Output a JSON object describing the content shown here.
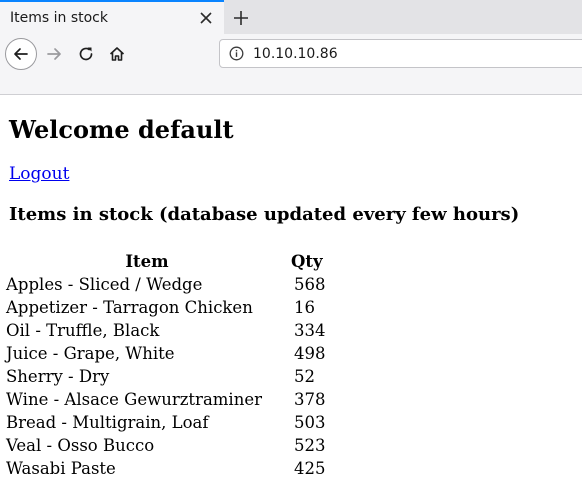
{
  "browser": {
    "tab_title": "Items in stock",
    "url": "10.10.10.86",
    "accent_color": "#0a84ff"
  },
  "page": {
    "welcome": "Welcome default",
    "logout_label": "Logout",
    "heading": "Items in stock (database updated every few hours)",
    "table": {
      "headers": [
        "Item",
        "Qty"
      ],
      "rows": [
        [
          "Apples - Sliced / Wedge",
          "568"
        ],
        [
          "Appetizer - Tarragon Chicken",
          "16"
        ],
        [
          "Oil - Truffle, Black",
          "334"
        ],
        [
          "Juice - Grape, White",
          "498"
        ],
        [
          "Sherry - Dry",
          "52"
        ],
        [
          "Wine - Alsace Gewurztraminer",
          "378"
        ],
        [
          "Bread - Multigrain, Loaf",
          "503"
        ],
        [
          "Veal - Osso Bucco",
          "523"
        ],
        [
          "Wasabi Paste",
          "425"
        ]
      ]
    }
  }
}
